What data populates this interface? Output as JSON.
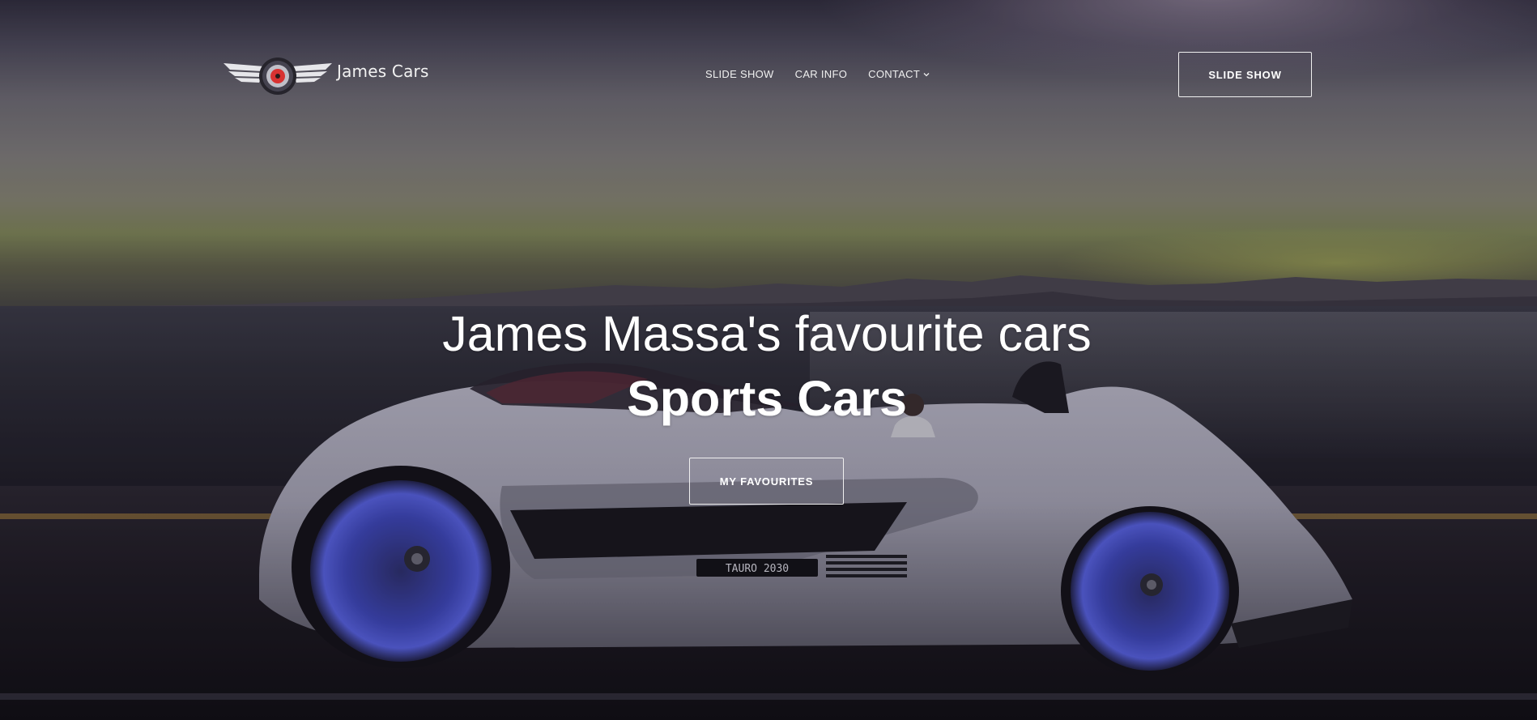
{
  "brand": {
    "name": "James Cars",
    "logo_icon": "winged-wheel-logo"
  },
  "nav": {
    "items": [
      {
        "label": "SLIDE SHOW"
      },
      {
        "label": "CAR INFO"
      },
      {
        "label": "CONTACT",
        "icon": "chevron-down-icon"
      }
    ]
  },
  "header_button": {
    "label": "SLIDE SHOW"
  },
  "hero": {
    "title": "James Massa's favourite cars",
    "subtitle": "Sports Cars",
    "button_label": "MY FAVOURITES",
    "car_badge": "TAURO 2030"
  },
  "colors": {
    "text": "#ffffff",
    "button_border": "#f0f0f0",
    "wheel_accent": "#4b56d6",
    "logo_accent": "#d83232"
  }
}
